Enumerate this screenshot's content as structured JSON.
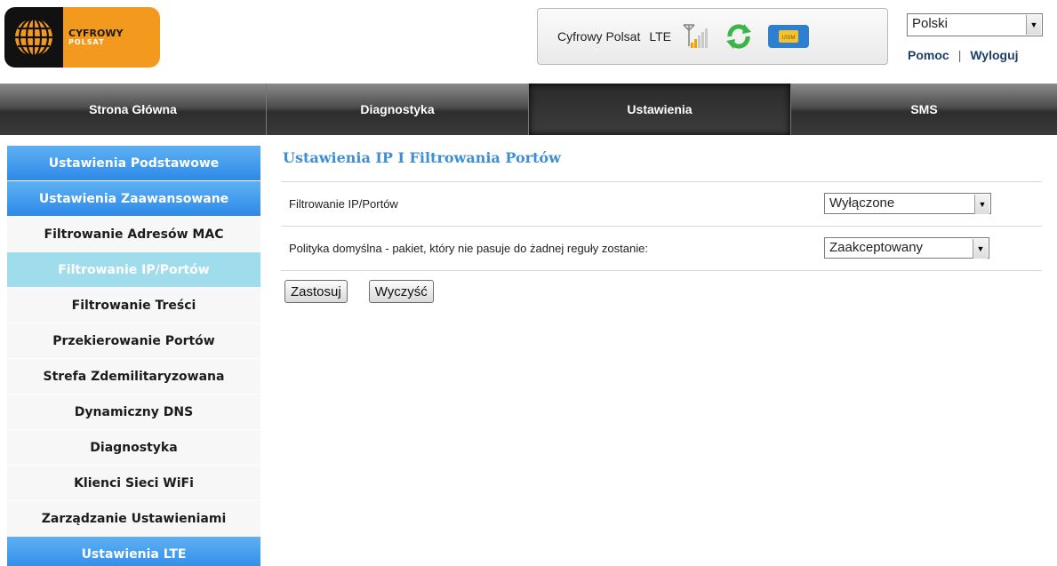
{
  "header": {
    "logo_line1": "CYFROWY",
    "logo_line2": "POLSAT",
    "operator": "Cyfrowy Polsat",
    "network_type": "LTE",
    "icons": [
      "signal-antenna-icon",
      "refresh-sync-icon",
      "usim-card-icon"
    ],
    "sim_label": "USIM",
    "language": "Polski",
    "help_link": "Pomoc",
    "separator": "|",
    "logout_link": "Wyloguj"
  },
  "nav": {
    "items": [
      {
        "label": "Strona Główna"
      },
      {
        "label": "Diagnostyka"
      },
      {
        "label": "Ustawienia"
      },
      {
        "label": "SMS"
      }
    ],
    "active": "Ustawienia"
  },
  "sidebar": {
    "items": [
      {
        "label": "Ustawienia Podstawowe"
      },
      {
        "label": "Ustawienia Zaawansowane"
      },
      {
        "label": "Filtrowanie Adresów MAC"
      },
      {
        "label": "Filtrowanie IP/Portów"
      },
      {
        "label": "Filtrowanie Treści"
      },
      {
        "label": "Przekierowanie Portów"
      },
      {
        "label": "Strefa Zdemilitaryzowana"
      },
      {
        "label": "Dynamiczny DNS"
      },
      {
        "label": "Diagnostyka"
      },
      {
        "label": "Klienci Sieci WiFi"
      },
      {
        "label": "Zarządzanie Ustawieniami"
      },
      {
        "label": "Ustawienia LTE"
      }
    ],
    "selected": "Filtrowanie IP/Portów"
  },
  "main": {
    "title": "Ustawienia IP I Filtrowania Portów",
    "fields": [
      {
        "label": "Filtrowanie IP/Portów",
        "value": "Wyłączone"
      },
      {
        "label": "Polityka domyślna - pakiet, który nie pasuje do żadnej reguły zostanie:",
        "value": "Zaakceptowany"
      }
    ],
    "apply_button": "Zastosuj",
    "clear_button": "Wyczyść"
  },
  "colors": {
    "accent_blue": "#3e8ed6",
    "sidebar_blue": "#2d8ae8",
    "sidebar_selected": "#9fdcec",
    "logo_orange": "#f39a1e"
  }
}
